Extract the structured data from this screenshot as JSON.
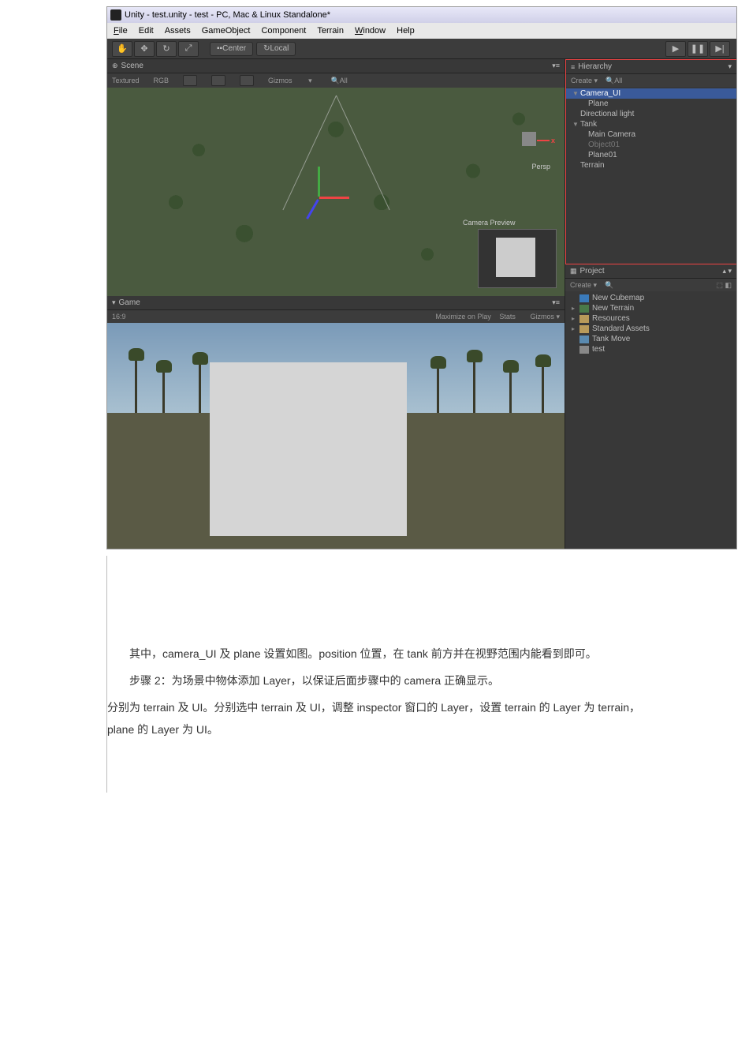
{
  "window": {
    "title": "Unity - test.unity - test - PC, Mac & Linux Standalone*"
  },
  "menubar": {
    "file": "File",
    "edit": "Edit",
    "assets": "Assets",
    "gameobject": "GameObject",
    "component": "Component",
    "terrain": "Terrain",
    "window": "Window",
    "help": "Help"
  },
  "toolbar": {
    "center": "Center",
    "local": "Local"
  },
  "scene": {
    "tab": "Scene",
    "textured": "Textured",
    "rgb": "RGB",
    "gizmos": "Gizmos",
    "persp": "Persp",
    "camera_preview": "Camera Preview"
  },
  "game": {
    "tab": "Game",
    "aspect": "16:9",
    "maximize": "Maximize on Play",
    "stats": "Stats",
    "gizmos": "Gizmos"
  },
  "hierarchy": {
    "tab": "Hierarchy",
    "create": "Create",
    "search_ph": "All",
    "items": {
      "camera_ui": "Camera_UI",
      "plane": "Plane",
      "dir_light": "Directional light",
      "tank": "Tank",
      "main_camera": "Main Camera",
      "object01": "Object01",
      "plane01": "Plane01",
      "terrain": "Terrain"
    }
  },
  "project": {
    "tab": "Project",
    "create": "Create",
    "items": {
      "new_cubemap": "New Cubemap",
      "new_terrain": "New Terrain",
      "resources": "Resources",
      "standard_assets": "Standard Assets",
      "tank_move": "Tank Move",
      "test": "test"
    }
  },
  "article": {
    "p1": "其中，camera_UI 及 plane 设置如图。position 位置，在 tank 前方并在视野范围内能看到即可。",
    "p2": "步骤 2：为场景中物体添加 Layer，以保证后面步骤中的 camera 正确显示。",
    "p3": "分别为 terrain 及 UI。分别选中 terrain 及 UI，调整 inspector 窗口的 Layer，设置 terrain 的 Layer 为 terrain，plane 的 Layer 为 UI。"
  }
}
